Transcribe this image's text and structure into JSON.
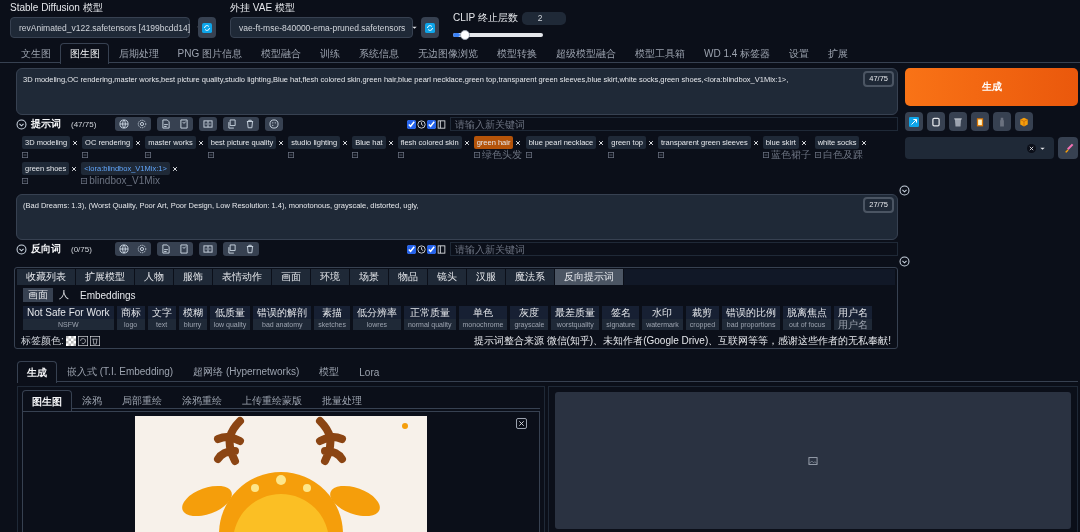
{
  "top": {
    "model_label": "Stable Diffusion 模型",
    "model_value": "revAnimated_v122.safetensors [4199bcdd14]",
    "vae_label": "外挂 VAE 模型",
    "vae_value": "vae-ft-mse-840000-ema-pruned.safetensors",
    "clip_label": "CLIP 终止层数",
    "clip_value": "2",
    "clip_slider": {
      "level": 0.08
    }
  },
  "main_tabs": [
    {
      "label": "文生图",
      "selected": false
    },
    {
      "label": "图生图",
      "selected": true
    },
    {
      "label": "后期处理",
      "selected": false
    },
    {
      "label": "PNG 图片信息",
      "selected": false
    },
    {
      "label": "模型融合",
      "selected": false
    },
    {
      "label": "训练",
      "selected": false
    },
    {
      "label": "系统信息",
      "selected": false
    },
    {
      "label": "无边图像浏览",
      "selected": false
    },
    {
      "label": "模型转换",
      "selected": false
    },
    {
      "label": "超级模型融合",
      "selected": false
    },
    {
      "label": "模型工具箱",
      "selected": false
    },
    {
      "label": "WD 1.4 标签器",
      "selected": false
    },
    {
      "label": "设置",
      "selected": false
    },
    {
      "label": "扩展",
      "selected": false
    }
  ],
  "prompt": {
    "text": "3D modeling,OC rendering,master works,best picture quality,studio lighting,Blue hat,flesh colored skin,green hair,blue pearl necklace,green top,transparent green sleeves,blue skirt,white socks,green shoes,<lora:blindbox_V1Mix:1>,",
    "counter": "47/75",
    "label": "提示词",
    "count": "(47/75)",
    "keyword_placeholder": "请输入新关键词",
    "checks": [
      {
        "checked": true
      },
      {
        "checked": true
      }
    ]
  },
  "prompt_tags": [
    {
      "text": "3D modeling",
      "kind": "tag",
      "highlighted": false
    },
    {
      "text": "OC rendering",
      "kind": "tag",
      "highlighted": false
    },
    {
      "text": "master works",
      "kind": "tag",
      "highlighted": false
    },
    {
      "text": "best picture quality",
      "kind": "tag",
      "highlighted": false
    },
    {
      "text": "studio lighting",
      "kind": "tag",
      "highlighted": false
    },
    {
      "text": "Blue hat",
      "kind": "tag",
      "highlighted": false
    },
    {
      "text": "flesh colored skin",
      "kind": "tag",
      "highlighted": false
    },
    {
      "text": "green hair",
      "translation": "绿色头发",
      "kind": "tag",
      "highlighted": true
    },
    {
      "text": "blue pearl necklace",
      "kind": "tag",
      "highlighted": false
    },
    {
      "text": "green top",
      "kind": "tag",
      "highlighted": false
    },
    {
      "text": "transparent green sleeves",
      "kind": "tag",
      "highlighted": false
    },
    {
      "text": "blue skirt",
      "translation": "蓝色裙子",
      "kind": "tag",
      "highlighted": false
    },
    {
      "text": "white socks",
      "translation": "白色及踝",
      "kind": "tag",
      "highlighted": false
    },
    {
      "text": "green shoes",
      "kind": "tag",
      "highlighted": false
    },
    {
      "text": "<lora:blindbox_V1Mix:1>",
      "translation": "blindbox_V1Mix",
      "kind": "lora",
      "highlighted": false
    }
  ],
  "negative": {
    "text": "(Bad Dreams: 1.3), (Worst Quality, Poor Art, Poor Design, Low Resolution: 1.4), monotonous, grayscale, distorted, ugly,",
    "counter": "27/75",
    "label": "反向词",
    "count": "(0/75)",
    "keyword_placeholder": "请输入新关键词",
    "checks": [
      {
        "checked": true
      },
      {
        "checked": true
      }
    ]
  },
  "category_tabs": [
    {
      "label": "收藏列表",
      "selected": false
    },
    {
      "label": "扩展模型",
      "selected": false
    },
    {
      "label": "人物",
      "selected": false
    },
    {
      "label": "服饰",
      "selected": false
    },
    {
      "label": "表情动作",
      "selected": false
    },
    {
      "label": "画面",
      "selected": false
    },
    {
      "label": "环境",
      "selected": false
    },
    {
      "label": "场景",
      "selected": false
    },
    {
      "label": "物品",
      "selected": false
    },
    {
      "label": "镜头",
      "selected": false
    },
    {
      "label": "汉服",
      "selected": false
    },
    {
      "label": "魔法系",
      "selected": false
    },
    {
      "label": "反向提示词",
      "selected": true
    }
  ],
  "sub_tabs": [
    {
      "label": "画面",
      "selected": true
    },
    {
      "label": "人",
      "selected": false
    },
    {
      "label": "Embeddings",
      "selected": false
    }
  ],
  "negative_tags": [
    {
      "text": "Not Safe For Work",
      "translation": "NSFW"
    },
    {
      "text": "商标",
      "translation": "logo"
    },
    {
      "text": "文字",
      "translation": "text"
    },
    {
      "text": "模糊",
      "translation": "blurry"
    },
    {
      "text": "低质量",
      "translation": "low quality"
    },
    {
      "text": "错误的解剖",
      "translation": "bad anatomy"
    },
    {
      "text": "素描",
      "translation": "sketches"
    },
    {
      "text": "低分辨率",
      "translation": "lowres"
    },
    {
      "text": "正常质量",
      "translation": "normal quality"
    },
    {
      "text": "单色",
      "translation": "monochrome"
    },
    {
      "text": "灰度",
      "translation": "grayscale"
    },
    {
      "text": "最差质量",
      "translation": "worstquality"
    },
    {
      "text": "签名",
      "translation": "signature"
    },
    {
      "text": "水印",
      "translation": "watermark"
    },
    {
      "text": "裁剪",
      "translation": "cropped"
    },
    {
      "text": "错误的比例",
      "translation": "bad proportions"
    },
    {
      "text": "脱离焦点",
      "translation": "out of focus"
    },
    {
      "text": "用户名",
      "translation": "用户名"
    }
  ],
  "tag_color_label": "标签颜色:",
  "credit": "提示词整合来源 微信(知乎)、未知作者(Google Drive)、互联网等等，感谢这些作者的无私奉献!",
  "generate_button": "生成",
  "bottom_tabs": [
    {
      "label": "生成",
      "selected": true
    },
    {
      "label": "嵌入式 (T.I. Embedding)",
      "selected": false
    },
    {
      "label": "超网络 (Hypernetworks)",
      "selected": false
    },
    {
      "label": "模型",
      "selected": false
    },
    {
      "label": "Lora",
      "selected": false
    }
  ],
  "image_tabs": [
    {
      "label": "图生图",
      "selected": true
    },
    {
      "label": "涂鸦",
      "selected": false
    },
    {
      "label": "局部重绘",
      "selected": false
    },
    {
      "label": "涂鸦重绘",
      "selected": false
    },
    {
      "label": "上传重绘蒙版",
      "selected": false
    },
    {
      "label": "批量处理",
      "selected": false
    }
  ]
}
